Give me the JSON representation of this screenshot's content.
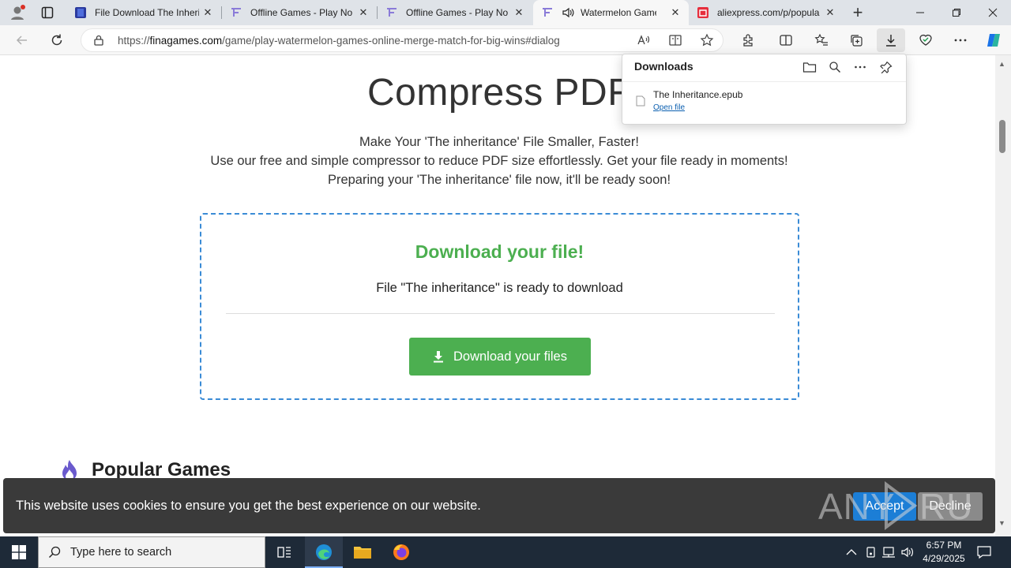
{
  "tabs": [
    {
      "title": "File Download The Inherit",
      "favicon": "blue-book-icon"
    },
    {
      "title": "Offline Games - Play No",
      "favicon": "fina-logo-icon"
    },
    {
      "title": "Offline Games - Play No",
      "favicon": "fina-logo-icon"
    },
    {
      "title": "Watermelon Game -",
      "favicon": "fina-logo-icon",
      "active": true,
      "audio": true
    },
    {
      "title": "aliexpress.com/p/popula",
      "favicon": "aliexpress-icon"
    }
  ],
  "address": {
    "scheme": "https://",
    "host": "finagames.com",
    "path": "/game/play-watermelon-games-online-merge-match-for-big-wins#dialog"
  },
  "downloads": {
    "title": "Downloads",
    "item_name": "The Inheritance.epub",
    "item_action": "Open file"
  },
  "page": {
    "heading": "Compress PDF",
    "lines": [
      "Make Your 'The inheritance' File Smaller, Faster!",
      "Use our free and simple compressor to reduce PDF size effortlessly. Get your file ready in moments!",
      "Preparing your 'The inheritance' file now, it'll be ready soon!"
    ],
    "box_title": "Download your file!",
    "box_subtitle": "File \"The inheritance\" is ready to download",
    "button": "Download your files",
    "popular": "Popular Games"
  },
  "cookie": {
    "text": "This website uses cookies to ensure you get the best experience on our website.",
    "accept": "Accept",
    "decline": "Decline"
  },
  "taskbar": {
    "search_placeholder": "Type here to search",
    "time": "6:57 PM",
    "date": "4/29/2025"
  },
  "colors": {
    "accent_green": "#4caf50",
    "dashed_border": "#3a8bd6",
    "accept_blue": "#1c7ed6"
  }
}
